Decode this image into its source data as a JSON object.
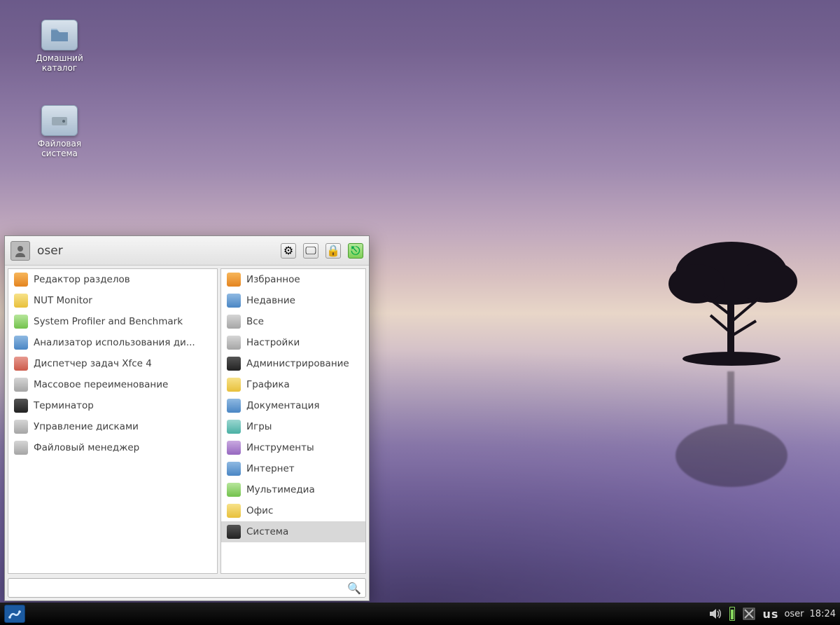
{
  "desktop": {
    "icons": [
      {
        "label": "Домашний каталог",
        "name": "home-folder-icon"
      },
      {
        "label": "Файловая система",
        "name": "filesystem-icon"
      }
    ]
  },
  "menu": {
    "username": "oser",
    "header_buttons": [
      {
        "name": "settings-button",
        "icon": "settings-icon"
      },
      {
        "name": "display-button",
        "icon": "display-icon"
      },
      {
        "name": "lock-button",
        "icon": "lock-icon"
      },
      {
        "name": "logout-button",
        "icon": "logout-icon"
      }
    ],
    "search_placeholder": "",
    "apps": [
      {
        "label": "Редактор разделов",
        "name": "app-partition-editor",
        "color": "c-orange"
      },
      {
        "label": "NUT Monitor",
        "name": "app-nut-monitor",
        "color": "c-yellow"
      },
      {
        "label": "System Profiler and Benchmark",
        "name": "app-system-profiler",
        "color": "c-green"
      },
      {
        "label": "Анализатор использования ди...",
        "name": "app-disk-usage-analyzer",
        "color": "c-blue"
      },
      {
        "label": "Диспетчер задач Xfce 4",
        "name": "app-xfce-task-manager",
        "color": "c-red"
      },
      {
        "label": "Массовое переименование",
        "name": "app-bulk-rename",
        "color": "c-grey"
      },
      {
        "label": "Терминатор",
        "name": "app-terminator",
        "color": "c-dark"
      },
      {
        "label": "Управление дисками",
        "name": "app-disk-management",
        "color": "c-grey"
      },
      {
        "label": "Файловый менеджер",
        "name": "app-file-manager",
        "color": "c-grey"
      }
    ],
    "categories": [
      {
        "label": "Избранное",
        "name": "cat-favorites",
        "color": "c-orange"
      },
      {
        "label": "Недавние",
        "name": "cat-recent",
        "color": "c-blue"
      },
      {
        "label": "Все",
        "name": "cat-all",
        "color": "c-grey"
      },
      {
        "label": "Настройки",
        "name": "cat-settings",
        "color": "c-grey"
      },
      {
        "label": "Администрирование",
        "name": "cat-admin",
        "color": "c-dark"
      },
      {
        "label": "Графика",
        "name": "cat-graphics",
        "color": "c-yellow"
      },
      {
        "label": "Документация",
        "name": "cat-docs",
        "color": "c-blue"
      },
      {
        "label": "Игры",
        "name": "cat-games",
        "color": "c-teal"
      },
      {
        "label": "Инструменты",
        "name": "cat-tools",
        "color": "c-purple"
      },
      {
        "label": "Интернет",
        "name": "cat-internet",
        "color": "c-blue"
      },
      {
        "label": "Мультимедиа",
        "name": "cat-multimedia",
        "color": "c-green"
      },
      {
        "label": "Офис",
        "name": "cat-office",
        "color": "c-yellow"
      },
      {
        "label": "Система",
        "name": "cat-system",
        "color": "c-dark",
        "selected": true
      }
    ]
  },
  "taskbar": {
    "keyboard_layout": "us",
    "user": "oser",
    "clock": "18:24"
  }
}
